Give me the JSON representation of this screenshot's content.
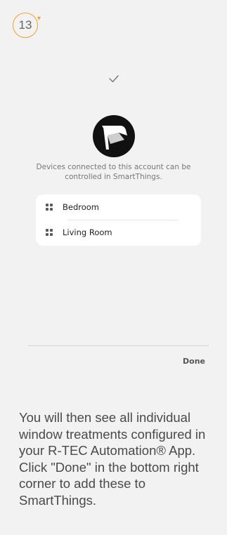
{
  "step": {
    "number": "13"
  },
  "icons": {
    "check": "checkmark-icon",
    "logo": "r-tec-logo-icon",
    "room": "room-grid-icon"
  },
  "info_text": "Devices connected to this account can be controlled in SmartThings.",
  "devices": [
    {
      "label": "Bedroom"
    },
    {
      "label": "Living Room"
    }
  ],
  "done_label": "Done",
  "instruction": "You will then see all individual window treatments configured in your R-TEC Automation® App. Click \"Done\" in the bottom right corner to add these to SmartThings.",
  "colors": {
    "accent": "#f0a030",
    "background": "#f2f2f2",
    "card": "#ffffff"
  }
}
